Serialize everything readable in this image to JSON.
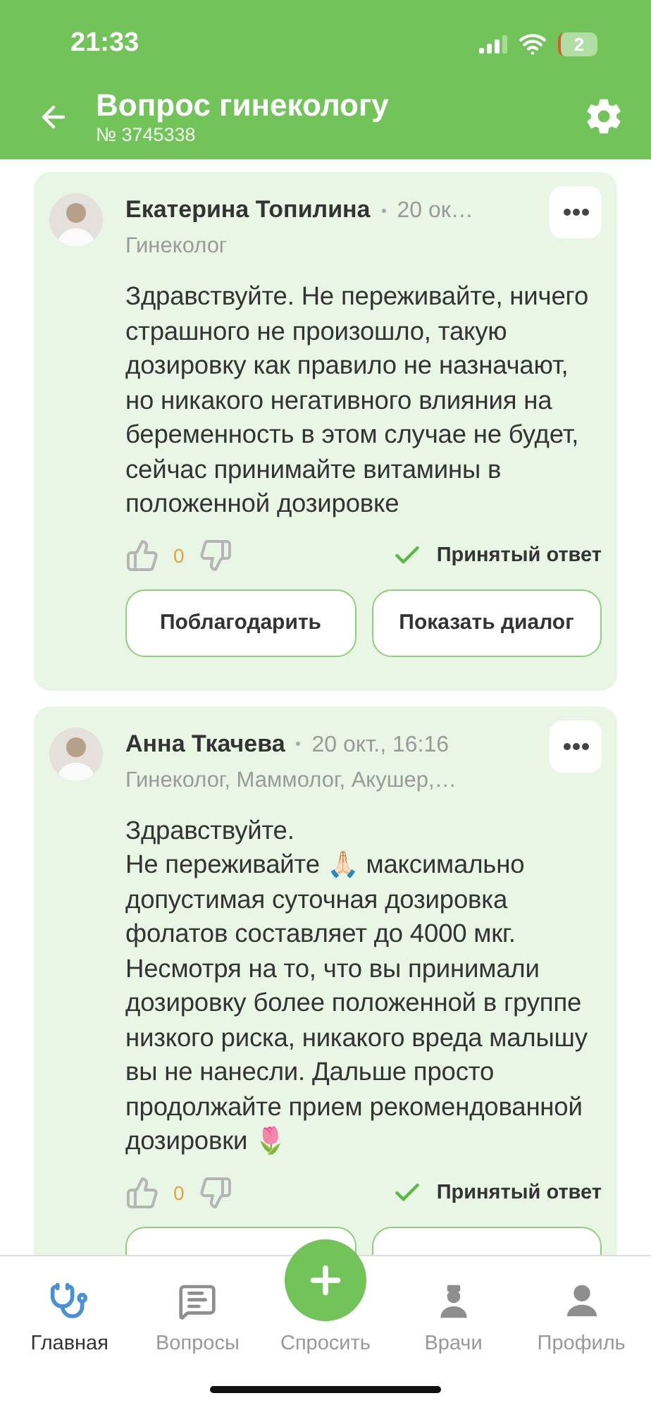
{
  "status_bar": {
    "time": "21:33",
    "battery": "2"
  },
  "header": {
    "title": "Вопрос гинекологу",
    "subtitle": "№ 3745338"
  },
  "answers": [
    {
      "author": "Екатерина Топилина",
      "date": "20 ок…",
      "specialty": "Гинеколог",
      "text": "Здравствуйте. Не переживайте, ничего страшного не произошло, такую дозировку как правило не назначают, но никакого негативного влияния на беременность в этом случае не будет, сейчас принимайте витамины в положенной дозировке",
      "likes": "0",
      "accepted": true,
      "accepted_label": "Принятый ответ",
      "buttons": [
        {
          "kind": "label",
          "label": "Поблагодарить"
        },
        {
          "kind": "label",
          "label": "Показать диалог"
        }
      ]
    },
    {
      "author": "Анна Ткачева",
      "date": "20 окт., 16:16",
      "specialty": "Гинеколог, Маммолог, Акушер,…",
      "text": "Здравствуйте.\nНе переживайте 🙏🏻 максимально допустимая суточная дозировка фолатов составляет до 4000 мкг. Несмотря на то, что вы принимали дозировку более положенной в группе низкого риска, никакого вреда малышу вы не нанесли. Дальше просто продолжайте прием рекомендованной дозировки 🌷",
      "likes": "0",
      "accepted": true,
      "accepted_label": "Принятый ответ",
      "buttons": [
        {
          "kind": "cut"
        },
        {
          "kind": "cut"
        }
      ]
    }
  ],
  "tab_bar": [
    {
      "kind": "home",
      "label": "Главная",
      "selected": true
    },
    {
      "kind": "questions",
      "label": "Вопросы",
      "selected": false
    },
    {
      "kind": "ask",
      "label": "Спросить",
      "selected": false
    },
    {
      "kind": "doctors",
      "label": "Врачи",
      "selected": false
    },
    {
      "kind": "profile",
      "label": "Профиль",
      "selected": false
    }
  ]
}
